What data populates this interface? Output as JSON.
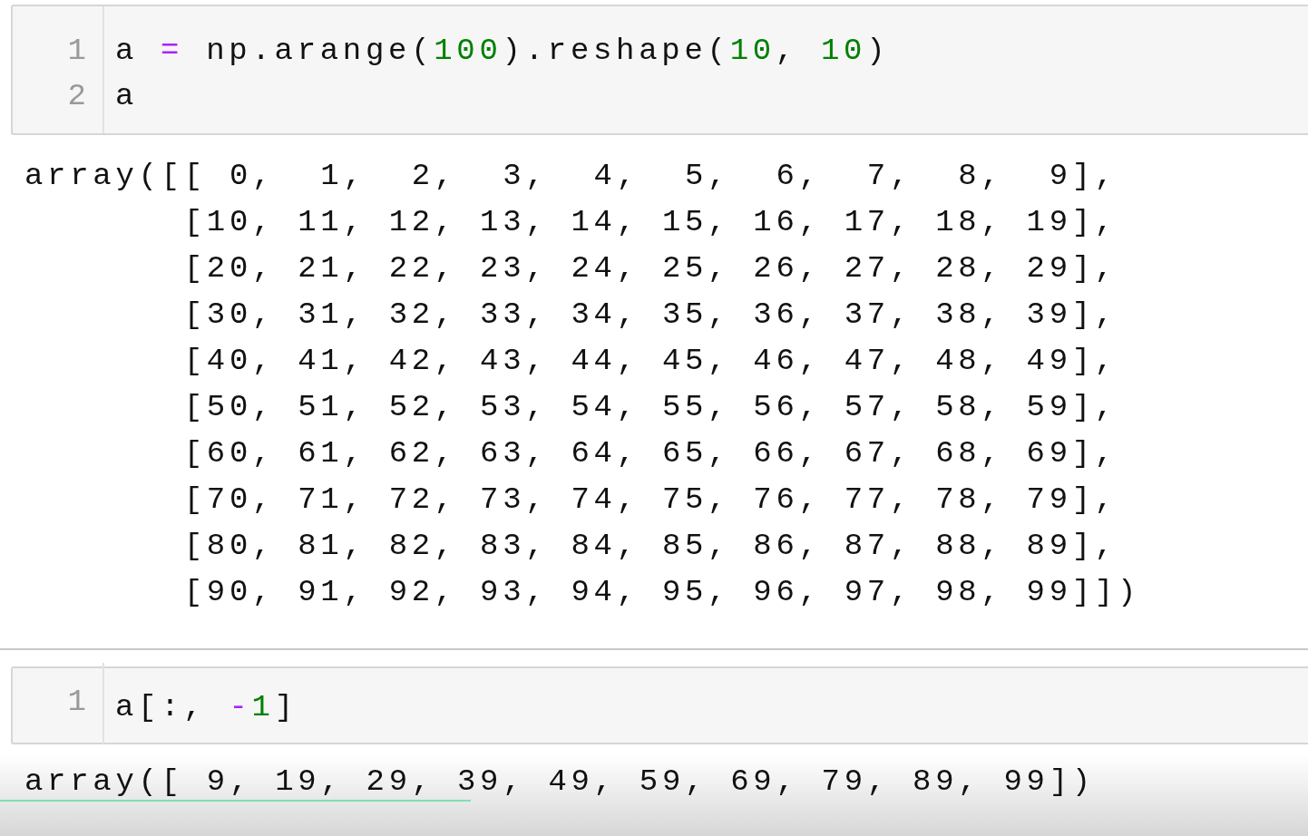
{
  "cells": [
    {
      "input": [
        {
          "number": "1",
          "tokens": [
            {
              "kind": "name",
              "text": "a"
            },
            {
              "kind": "operator",
              "text": "="
            },
            {
              "kind": "name",
              "text": "np.arange("
            },
            {
              "kind": "number",
              "text": "100"
            },
            {
              "kind": "name",
              "text": ").reshape("
            },
            {
              "kind": "number",
              "text": "10"
            },
            {
              "kind": "name",
              "text": ","
            },
            {
              "kind": "number",
              "text": "10"
            },
            {
              "kind": "name",
              "text": ")"
            }
          ]
        },
        {
          "number": "2",
          "tokens": [
            {
              "kind": "name",
              "text": "a"
            }
          ]
        }
      ],
      "output": [
        "array([[ 0,  1,  2,  3,  4,  5,  6,  7,  8,  9],",
        "       [10, 11, 12, 13, 14, 15, 16, 17, 18, 19],",
        "       [20, 21, 22, 23, 24, 25, 26, 27, 28, 29],",
        "       [30, 31, 32, 33, 34, 35, 36, 37, 38, 39],",
        "       [40, 41, 42, 43, 44, 45, 46, 47, 48, 49],",
        "       [50, 51, 52, 53, 54, 55, 56, 57, 58, 59],",
        "       [60, 61, 62, 63, 64, 65, 66, 67, 68, 69],",
        "       [70, 71, 72, 73, 74, 75, 76, 77, 78, 79],",
        "       [80, 81, 82, 83, 84, 85, 86, 87, 88, 89],",
        "       [90, 91, 92, 93, 94, 95, 96, 97, 98, 99]])"
      ]
    },
    {
      "input": [
        {
          "number": "1",
          "tokens": [
            {
              "kind": "name",
              "text": "a[:,"
            },
            {
              "kind": "operator",
              "text": "-"
            },
            {
              "kind": "number",
              "text": "1"
            },
            {
              "kind": "name",
              "text": "]"
            }
          ]
        }
      ],
      "output": [
        "array([ 9, 19, 29, 39, 49, 59, 69, 79, 89, 99])"
      ]
    }
  ],
  "video_progress": {
    "level": 0.36
  }
}
